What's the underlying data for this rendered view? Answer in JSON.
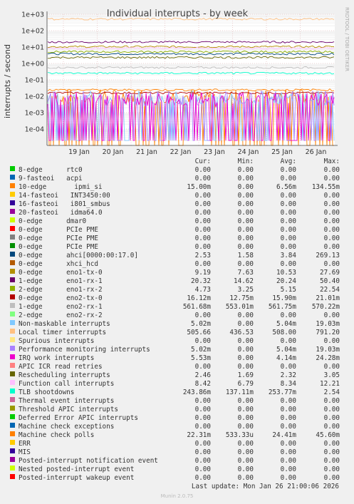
{
  "chart_data": {
    "type": "line",
    "title": "Individual interrupts - by week",
    "ylabel": "interrupts / second",
    "y_scale": "log",
    "ylim": [
      1e-05,
      1000
    ],
    "y_ticks": [
      "1e+03",
      "1e+02",
      "1e+01",
      "1e+00",
      "1e-01",
      "1e-02",
      "1e-03",
      "1e-04"
    ],
    "x_ticks": [
      "19 Jan",
      "20 Jan",
      "21 Jan",
      "22 Jan",
      "23 Jan",
      "24 Jan",
      "25 Jan",
      "26 Jan"
    ],
    "grid": true,
    "columns": [
      "Cur:",
      "Min:",
      "Avg:",
      "Max:"
    ],
    "series": [
      {
        "name": "8-edge      rtc0",
        "color": "#00cc00",
        "cur": "0.00",
        "min": "0.00",
        "avg": "0.00",
        "max": "0.00"
      },
      {
        "name": "9-fasteoi   acpi",
        "color": "#0066b3",
        "cur": "0.00",
        "min": "0.00",
        "avg": "0.00",
        "max": "0.00"
      },
      {
        "name": "10-edge       ipmi_si",
        "color": "#ff8000",
        "cur": "15.00m",
        "min": "0.00",
        "avg": "6.56m",
        "max": "134.55m"
      },
      {
        "name": "14-fasteoi   INT3450:00",
        "color": "#ffcc00",
        "cur": "0.00",
        "min": "0.00",
        "avg": "0.00",
        "max": "0.00"
      },
      {
        "name": "16-fasteoi   i801_smbus",
        "color": "#330099",
        "cur": "0.00",
        "min": "0.00",
        "avg": "0.00",
        "max": "0.00"
      },
      {
        "name": "20-fasteoi   idma64.0",
        "color": "#990099",
        "cur": "0.00",
        "min": "0.00",
        "avg": "0.00",
        "max": "0.00"
      },
      {
        "name": "0-edge      dmar0",
        "color": "#ccff00",
        "cur": "0.00",
        "min": "0.00",
        "avg": "0.00",
        "max": "0.00"
      },
      {
        "name": "0-edge      PCIe PME",
        "color": "#ff0000",
        "cur": "0.00",
        "min": "0.00",
        "avg": "0.00",
        "max": "0.00"
      },
      {
        "name": "0-edge      PCIe PME",
        "color": "#808080",
        "cur": "0.00",
        "min": "0.00",
        "avg": "0.00",
        "max": "0.00"
      },
      {
        "name": "0-edge      PCIe PME",
        "color": "#008f00",
        "cur": "0.00",
        "min": "0.00",
        "avg": "0.00",
        "max": "0.00"
      },
      {
        "name": "0-edge      ahci[0000:00:17.0]",
        "color": "#00487d",
        "cur": "2.53",
        "min": "1.58",
        "avg": "3.84",
        "max": "269.13"
      },
      {
        "name": "0-edge      xhci_hcd",
        "color": "#b35a00",
        "cur": "0.00",
        "min": "0.00",
        "avg": "0.00",
        "max": "0.00"
      },
      {
        "name": "0-edge      eno1-tx-0",
        "color": "#b38f00",
        "cur": "9.19",
        "min": "7.63",
        "avg": "10.53",
        "max": "27.69"
      },
      {
        "name": "1-edge      eno1-rx-1",
        "color": "#6b006b",
        "cur": "20.32",
        "min": "14.62",
        "avg": "20.24",
        "max": "50.40"
      },
      {
        "name": "2-edge      eno1-rx-2",
        "color": "#8fb300",
        "cur": "4.73",
        "min": "3.25",
        "avg": "5.15",
        "max": "22.54"
      },
      {
        "name": "0-edge      eno2-tx-0",
        "color": "#b30000",
        "cur": "16.12m",
        "min": "12.75m",
        "avg": "15.90m",
        "max": "21.01m"
      },
      {
        "name": "1-edge      eno2-rx-1",
        "color": "#bebebe",
        "cur": "561.68m",
        "min": "553.01m",
        "avg": "561.75m",
        "max": "570.22m"
      },
      {
        "name": "2-edge      eno2-rx-2",
        "color": "#80ff80",
        "cur": "0.00",
        "min": "0.00",
        "avg": "0.00",
        "max": "0.00"
      },
      {
        "name": "Non-maskable interrupts",
        "color": "#80c9ff",
        "cur": "5.02m",
        "min": "0.00",
        "avg": "5.04m",
        "max": "19.03m"
      },
      {
        "name": "Local timer interrupts",
        "color": "#ffc080",
        "cur": "505.66",
        "min": "436.53",
        "avg": "508.00",
        "max": "791.20"
      },
      {
        "name": "Spurious interrupts",
        "color": "#ffe680",
        "cur": "0.00",
        "min": "0.00",
        "avg": "0.00",
        "max": "0.00"
      },
      {
        "name": "Performance monitoring interrupts",
        "color": "#aa80ff",
        "cur": "5.02m",
        "min": "0.00",
        "avg": "5.04m",
        "max": "19.03m"
      },
      {
        "name": "IRQ work interrupts",
        "color": "#ee00cc",
        "cur": "5.53m",
        "min": "0.00",
        "avg": "4.14m",
        "max": "24.28m"
      },
      {
        "name": "APIC ICR read retries",
        "color": "#ff8080",
        "cur": "0.00",
        "min": "0.00",
        "avg": "0.00",
        "max": "0.00"
      },
      {
        "name": "Rescheduling interrupts",
        "color": "#666600",
        "cur": "2.46",
        "min": "1.69",
        "avg": "2.32",
        "max": "3.05"
      },
      {
        "name": "Function call interrupts",
        "color": "#ffbfff",
        "cur": "8.42",
        "min": "6.79",
        "avg": "8.34",
        "max": "12.21"
      },
      {
        "name": "TLB shootdowns",
        "color": "#00ffcc",
        "cur": "243.86m",
        "min": "137.11m",
        "avg": "253.77m",
        "max": "2.54"
      },
      {
        "name": "Thermal event interrupts",
        "color": "#cc6699",
        "cur": "0.00",
        "min": "0.00",
        "avg": "0.00",
        "max": "0.00"
      },
      {
        "name": "Threshold APIC interrupts",
        "color": "#999900",
        "cur": "0.00",
        "min": "0.00",
        "avg": "0.00",
        "max": "0.00"
      },
      {
        "name": "Deferred Error APIC interrupts",
        "color": "#00cc00",
        "cur": "0.00",
        "min": "0.00",
        "avg": "0.00",
        "max": "0.00"
      },
      {
        "name": "Machine check exceptions",
        "color": "#0066b3",
        "cur": "0.00",
        "min": "0.00",
        "avg": "0.00",
        "max": "0.00"
      },
      {
        "name": "Machine check polls",
        "color": "#ff8000",
        "cur": "22.31m",
        "min": "533.33u",
        "avg": "24.41m",
        "max": "45.60m"
      },
      {
        "name": "ERR",
        "color": "#ffcc00",
        "cur": "0.00",
        "min": "0.00",
        "avg": "0.00",
        "max": "0.00"
      },
      {
        "name": "MIS",
        "color": "#330099",
        "cur": "0.00",
        "min": "0.00",
        "avg": "0.00",
        "max": "0.00"
      },
      {
        "name": "Posted-interrupt notification event",
        "color": "#990099",
        "cur": "0.00",
        "min": "0.00",
        "avg": "0.00",
        "max": "0.00"
      },
      {
        "name": "Nested posted-interrupt event",
        "color": "#ccff00",
        "cur": "0.00",
        "min": "0.00",
        "avg": "0.00",
        "max": "0.00"
      },
      {
        "name": "Posted-interrupt wakeup event",
        "color": "#ff0000",
        "cur": "0.00",
        "min": "0.00",
        "avg": "0.00",
        "max": "0.00"
      }
    ]
  },
  "side_label": "RRDTOOL / TOBI OETIKER",
  "footer": {
    "last_update": "Last update: Mon Jan 26 21:00:06 2026",
    "munin": "Munin 2.0.75"
  }
}
